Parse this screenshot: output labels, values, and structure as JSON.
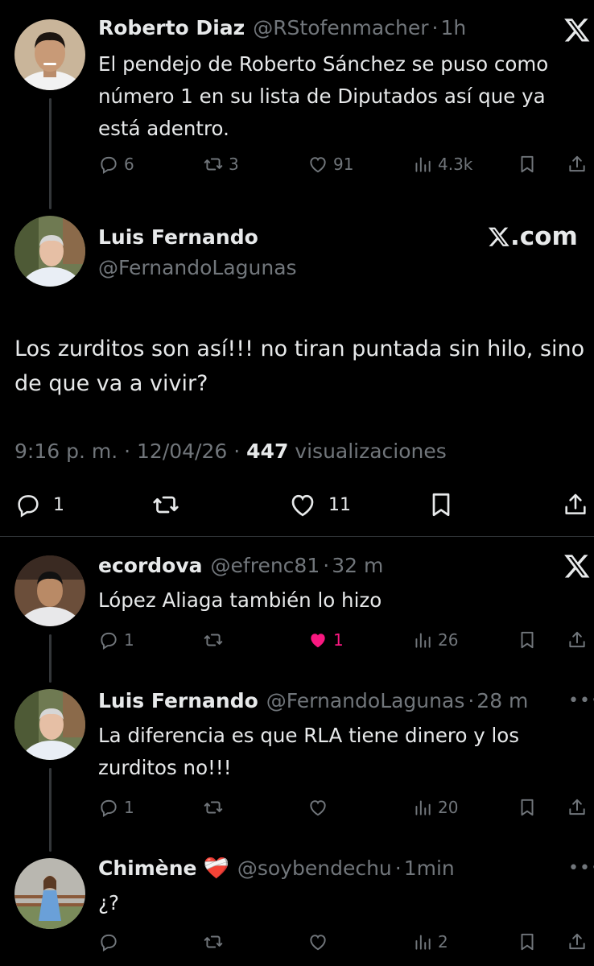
{
  "tweet1": {
    "name": "Roberto Diaz",
    "handle": "@RStofenmacher",
    "time": "1h",
    "text": "El pendejo de Roberto Sánchez se puso como número 1 en su lista de Diputados así que ya está adentro.",
    "replies": "6",
    "retweets": "3",
    "likes": "91",
    "views": "4.3k"
  },
  "main": {
    "name": "Luis Fernando",
    "handle": "@FernandoLagunas",
    "brand": ".com",
    "text": "Los zurditos son así!!! no tiran puntada sin hilo, sino de que va a vivir?",
    "time": "9:16 p. m.",
    "date": "12/04/26",
    "views_count": "447",
    "views_label": "visualizaciones",
    "replies": "1",
    "likes": "11"
  },
  "reply1": {
    "name": "ecordova",
    "handle": "@efrenc81",
    "time": "32 m",
    "text": "López Aliaga también lo hizo",
    "replies": "1",
    "likes": "1",
    "views": "26"
  },
  "reply2": {
    "name": "Luis Fernando",
    "handle": "@FernandoLagunas",
    "time": "28 m",
    "text": "La diferencia es que RLA tiene dinero y los zurditos no!!!",
    "replies": "1",
    "views": "20"
  },
  "reply3": {
    "name": "Chimène",
    "emoji": "❤️‍🩹",
    "handle": "@soybendechu",
    "time": "1min",
    "text": "¿?",
    "views": "2"
  },
  "colors": {
    "background": "#000000",
    "text": "#e7e9ea",
    "muted": "#71767b",
    "like": "#f91880"
  },
  "icons": [
    "x-logo-icon",
    "reply-icon",
    "retweet-icon",
    "like-icon",
    "views-icon",
    "bookmark-icon",
    "share-icon",
    "more-icon"
  ]
}
